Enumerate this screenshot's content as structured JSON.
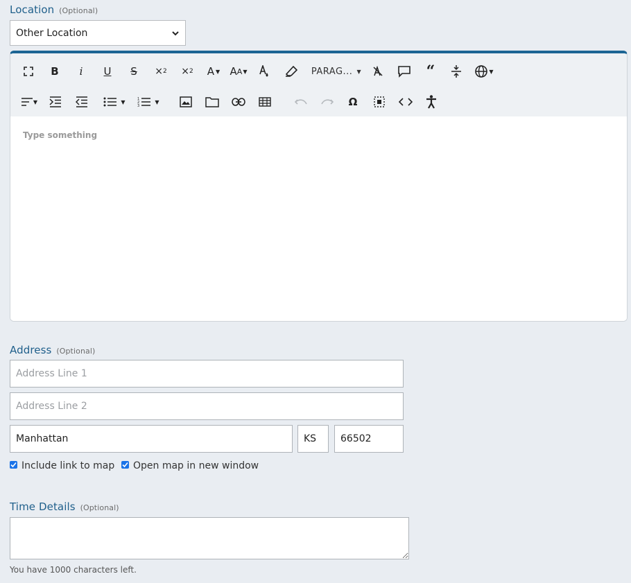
{
  "location": {
    "label": "Location",
    "optional": "(Optional)",
    "selected": "Other Location"
  },
  "editor": {
    "placeholder": "Type something",
    "paragraph_format": "PARAG...",
    "toolbar_icons": [
      "fullscreen-icon",
      "bold-icon",
      "italic-icon",
      "underline-icon",
      "strikethrough-icon",
      "subscript-icon",
      "superscript-icon",
      "font-family-icon",
      "font-size-icon",
      "text-color-icon",
      "highlight-icon",
      "paragraph-format",
      "clear-formatting-icon",
      "comment-icon",
      "quote-icon",
      "horizontal-line-icon",
      "language-icon",
      "align-icon",
      "indent-icon",
      "outdent-icon",
      "unordered-list-icon",
      "ordered-list-icon",
      "insert-image-icon",
      "insert-file-icon",
      "insert-link-icon",
      "insert-table-icon",
      "undo-icon",
      "redo-icon",
      "special-characters-icon",
      "select-all-icon",
      "code-view-icon",
      "accessibility-icon"
    ],
    "accent": "#1c6594"
  },
  "address": {
    "label": "Address",
    "optional": "(Optional)",
    "line1_placeholder": "Address Line 1",
    "line2_placeholder": "Address Line 2",
    "city": "Manhattan",
    "state": "KS",
    "zip": "66502",
    "include_map": "Include link to map",
    "new_window": "Open map in new window"
  },
  "time": {
    "label": "Time Details",
    "optional": "(Optional)",
    "counter": "You have 1000 characters left."
  }
}
